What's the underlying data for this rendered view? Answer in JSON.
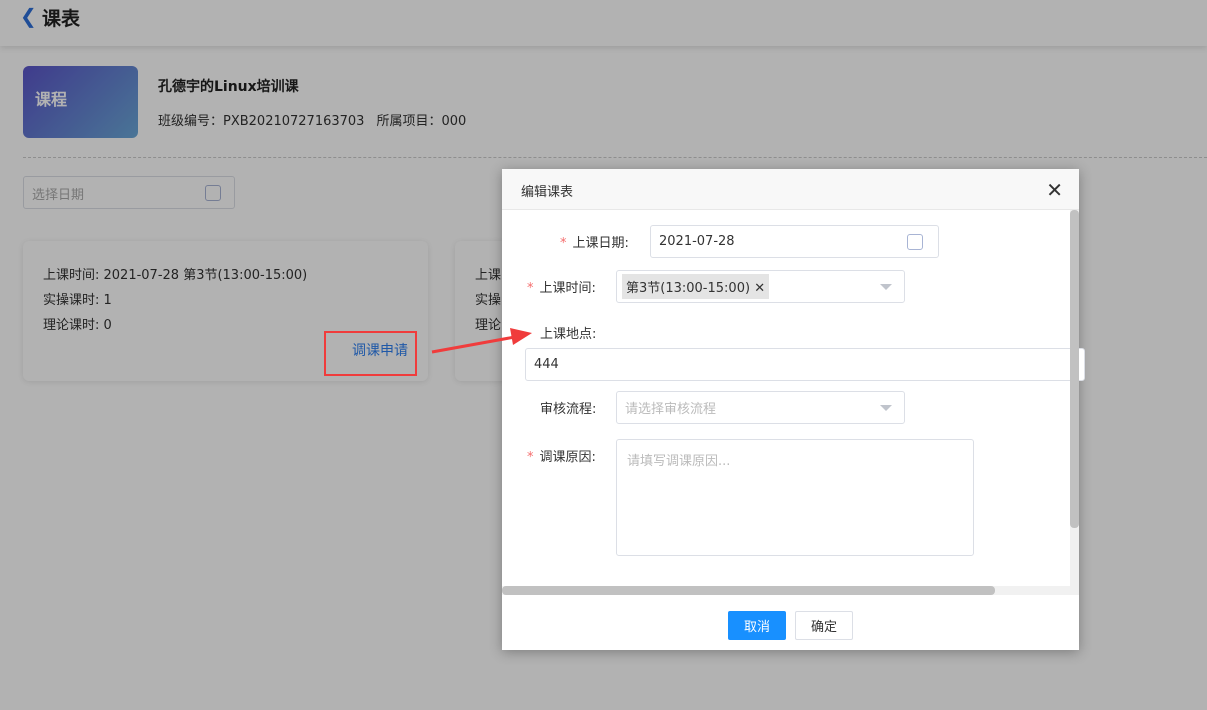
{
  "header": {
    "back_icon": "chevron-left-icon",
    "title": "课表"
  },
  "course": {
    "thumb_label": "课程",
    "name": "孔德宇的Linux培训课",
    "class_no": "班级编号：PXB20210727163703",
    "project": "所属项目：000"
  },
  "filter": {
    "date_placeholder": "选择日期"
  },
  "cards": [
    {
      "time": "上课时间: 2021-07-28 第3节(13:00-15:00)",
      "practice": "实操课时: 1",
      "theory": "理论课时: 0",
      "action": "调课申请"
    },
    {
      "time": "上课",
      "practice": "实操",
      "theory": "理论"
    }
  ],
  "dialog": {
    "title": "编辑课表",
    "date_label": "上课日期:",
    "date_value": "2021-07-28",
    "time_label": "上课时间:",
    "time_tag": "第3节(13:00-15:00)",
    "place_label": "上课地点:",
    "place_value": "444",
    "flow_label": "审核流程:",
    "flow_placeholder": "请选择审核流程",
    "reason_label": "调课原因:",
    "reason_placeholder": "请填写调课原因...",
    "cancel": "取消",
    "confirm": "确定",
    "required_mark": "*"
  },
  "colors": {
    "primary": "#1890ff",
    "annotation": "#f03c3c"
  }
}
